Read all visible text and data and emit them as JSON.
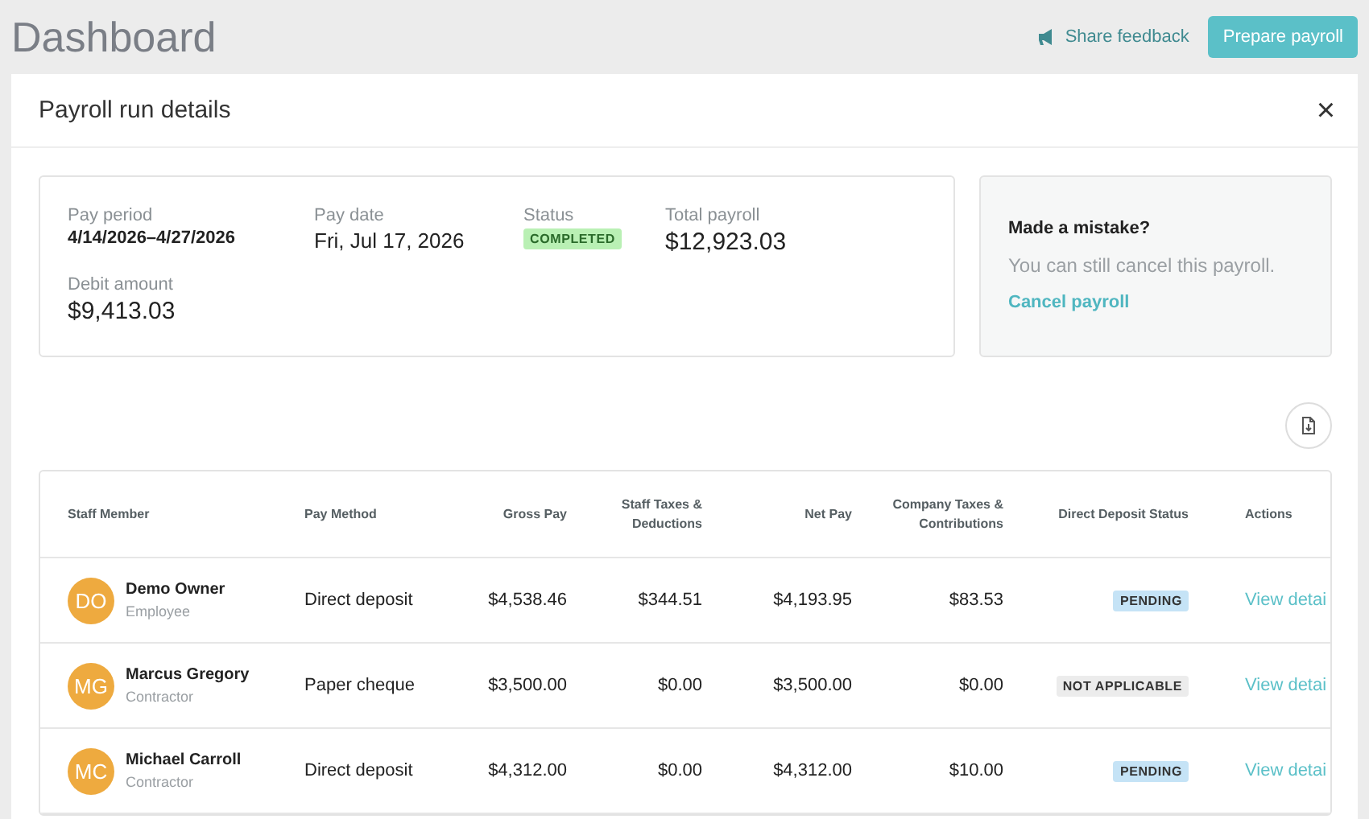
{
  "page": {
    "title": "Dashboard",
    "feedback": "Share feedback",
    "primary_action": "Prepare payroll"
  },
  "modal": {
    "title": "Payroll run details",
    "close": "×",
    "summary": [
      {
        "label": "Pay period",
        "value": "4/14/2026–4/27/2026",
        "kind": "small"
      },
      {
        "label": "Pay date",
        "value": "Fri, Jul 17, 2026",
        "kind": "text"
      },
      {
        "label": "Status",
        "value": "COMPLETED",
        "kind": "badge"
      },
      {
        "label": "Total payroll",
        "value": "$12,923.03",
        "kind": "large"
      },
      {
        "label": "Debit amount",
        "value": "$9,413.03",
        "kind": "large"
      }
    ],
    "mistake": {
      "title": "Made a mistake?",
      "text": "You can still cancel this payroll.",
      "link": "Cancel payroll"
    },
    "table": {
      "columns": [
        "Staff Member",
        "Pay Method",
        "Gross Pay",
        "Staff Taxes & Deductions",
        "Net Pay",
        "Company Taxes & Contributions",
        "Direct Deposit Status",
        "Actions"
      ],
      "rows": [
        {
          "initials": "DO",
          "name": "Demo Owner",
          "role": "Employee",
          "method": "Direct deposit",
          "gross": "$4,538.46",
          "staff_taxes": "$344.51",
          "net": "$4,193.95",
          "company_taxes": "$83.53",
          "status": {
            "label": "PENDING",
            "kind": "pending"
          },
          "action": "View detai"
        },
        {
          "initials": "MG",
          "name": "Marcus Gregory",
          "role": "Contractor",
          "method": "Paper cheque",
          "gross": "$3,500.00",
          "staff_taxes": "$0.00",
          "net": "$3,500.00",
          "company_taxes": "$0.00",
          "status": {
            "label": "NOT APPLICABLE",
            "kind": "na"
          },
          "action": "View detai"
        },
        {
          "initials": "MC",
          "name": "Michael Carroll",
          "role": "Contractor",
          "method": "Direct deposit",
          "gross": "$4,312.00",
          "staff_taxes": "$0.00",
          "net": "$4,312.00",
          "company_taxes": "$10.00",
          "status": {
            "label": "PENDING",
            "kind": "pending"
          },
          "action": "View detai"
        }
      ]
    }
  }
}
